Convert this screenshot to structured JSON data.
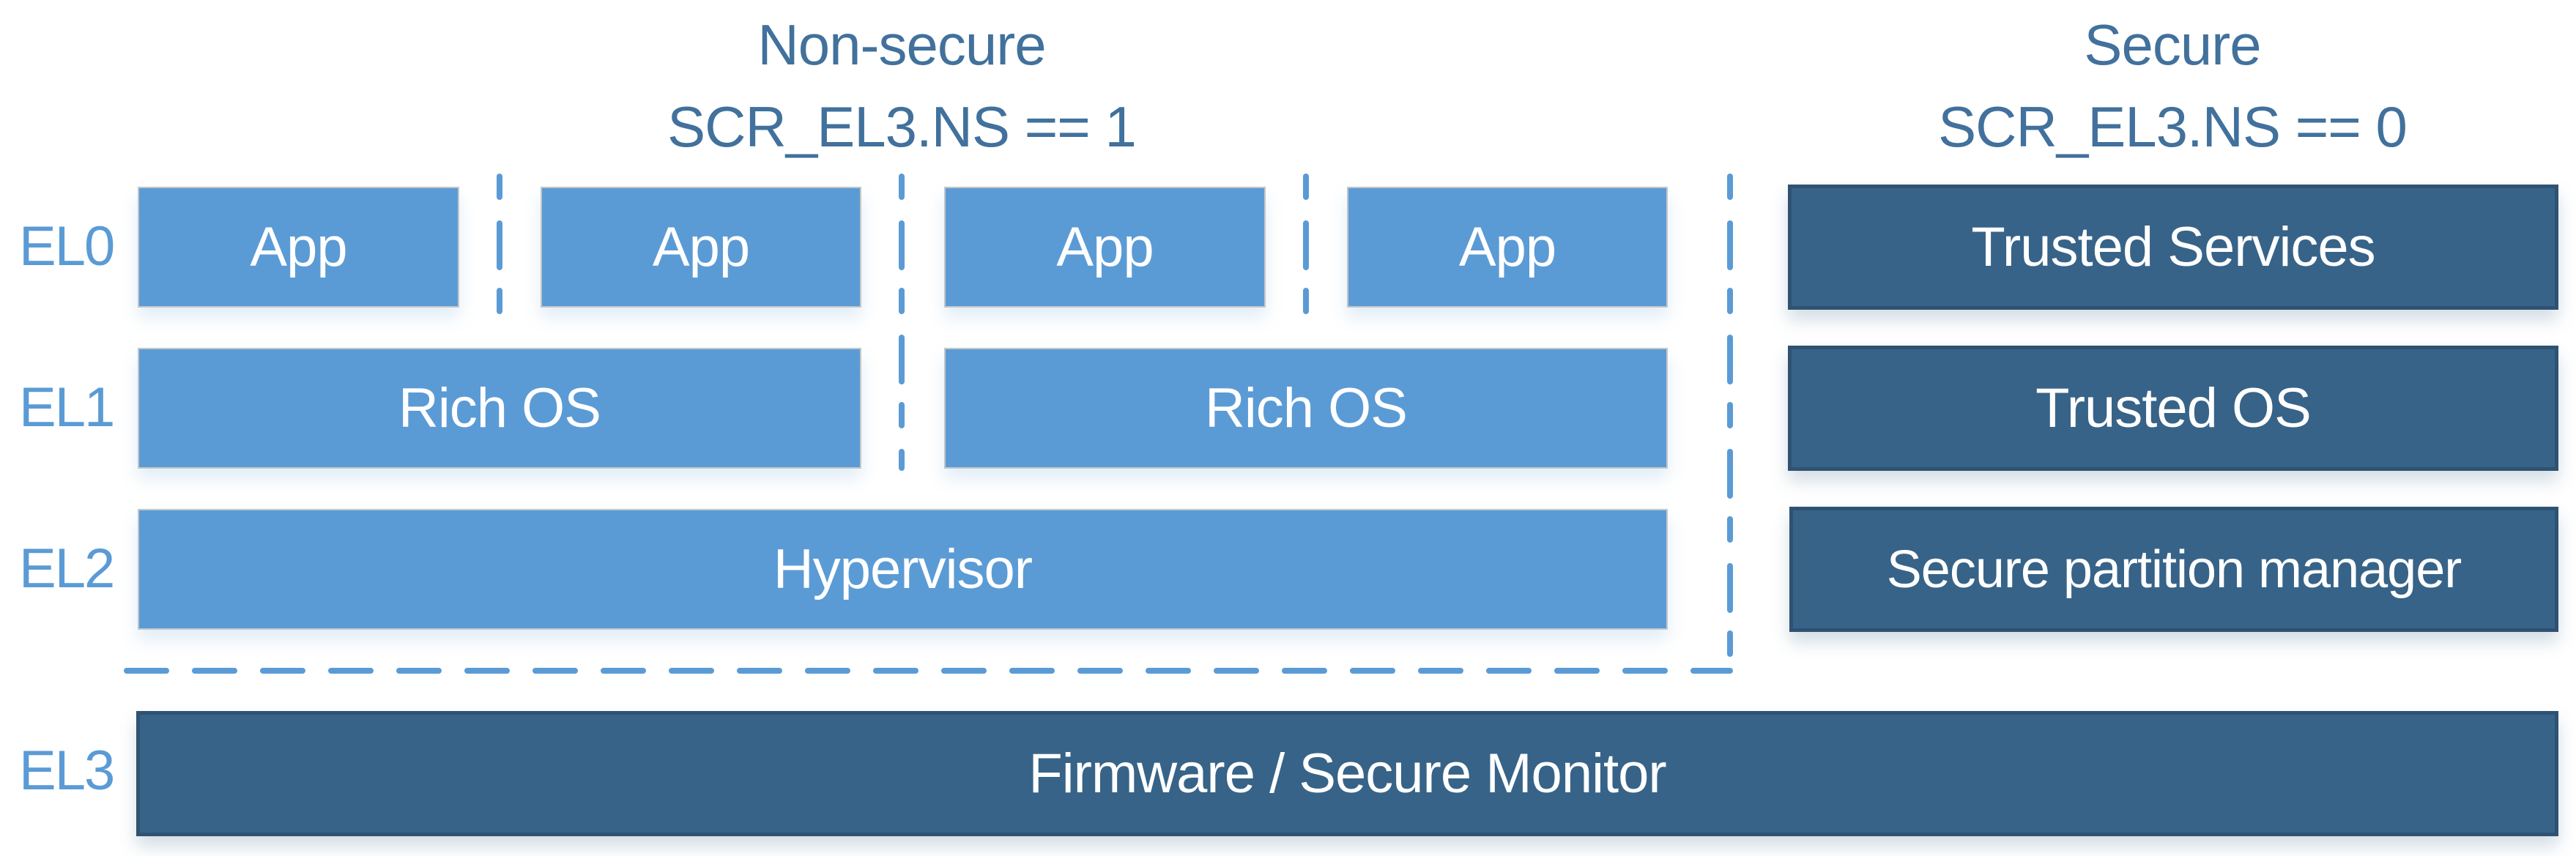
{
  "headers": {
    "nonsecure": {
      "title": "Non-secure",
      "condition": "SCR_EL3.NS == 1"
    },
    "secure": {
      "title": "Secure",
      "condition": "SCR_EL3.NS == 0"
    }
  },
  "levels": [
    "EL0",
    "EL1",
    "EL2",
    "EL3"
  ],
  "nonsecure": {
    "el0_apps": [
      "App",
      "App",
      "App",
      "App"
    ],
    "el1_os": [
      "Rich OS",
      "Rich OS"
    ],
    "el2": "Hypervisor"
  },
  "secure": {
    "el0": "Trusted Services",
    "el1": "Trusted OS",
    "el2": "Secure partition manager"
  },
  "el3": "Firmware / Secure Monitor",
  "colors": {
    "nonsecure_box": "#5b9bd5",
    "secure_box": "#376388",
    "title_text": "#41719c",
    "level_label": "#5b9bd5",
    "dashed_line": "#5b9bd5"
  }
}
